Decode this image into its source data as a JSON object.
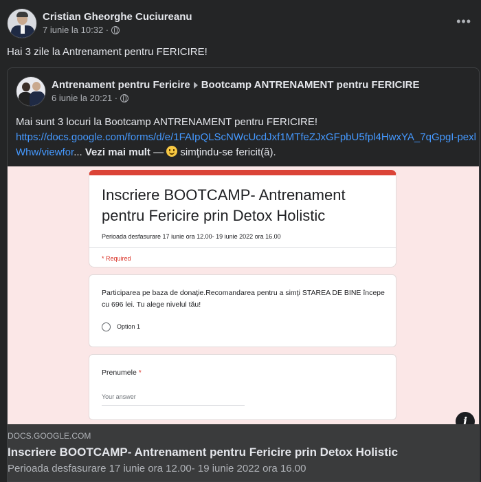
{
  "post": {
    "author": "Cristian Gheorghe Cuciureanu",
    "time": "7 iunie la 10:32 ·",
    "text": "Hai 3 zile la Antrenament pentru FERICIRE!",
    "more": "•••"
  },
  "shared": {
    "group": "Antrenament pentru Fericire",
    "event": "Bootcamp ANTRENAMENT pentru FERICIRE",
    "time": "6 iunie la 20:21 ·",
    "text_line1": "Mai sunt 3 locuri  la  Bootcamp ANTRENAMENT pentru FERICIRE!",
    "link": "https://docs.google.com/forms/d/e/1FAIpQLScNWcUcdJxf1MTfeZJxGFpbU5fpl4HwxYA_7qGpgI-pexlWhw/viewfor",
    "ellipsis": "...",
    "see_more": "Vezi mai mult",
    "feeling": "— ",
    "feeling_text": " simţindu-se fericit(ă)."
  },
  "form_preview": {
    "title": "Inscriere BOOTCAMP- Antrenament pentru Fericire prin Detox Holistic",
    "subtitle": "Perioada desfasurare 17 iunie ora 12.00- 19 iunie 2022 ora 16.00",
    "required": "* Required",
    "q1": "Participarea pe baza de donaţie.Recomandarea pentru a simţi STAREA DE BINE începe cu 696 lei. Tu alege nivelul tău!",
    "option1": "Option 1",
    "q2_label": "Prenumele",
    "q2_star": "*",
    "q2_placeholder": "Your answer"
  },
  "link_card": {
    "domain": "DOCS.GOOGLE.COM",
    "title": "Inscriere BOOTCAMP- Antrenament pentru Fericire prin Detox Holistic",
    "description": "Perioada desfasurare 17 iunie ora 12.00- 19 iunie 2022 ora 16.00",
    "info": "i"
  },
  "colors": {
    "background": "#242526",
    "link": "#4599ff",
    "form_accent": "#db4437",
    "preview_bg": "#fbe7e7"
  }
}
